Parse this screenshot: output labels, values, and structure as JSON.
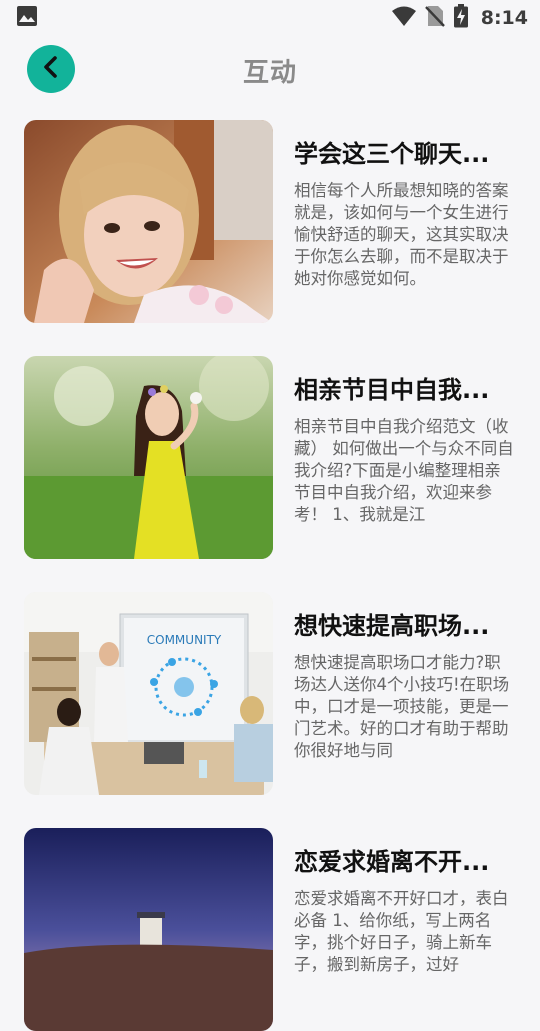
{
  "status_bar": {
    "time": "8:14",
    "icons": [
      "image-icon",
      "wifi-icon",
      "no-sim-icon",
      "battery-charging-icon"
    ]
  },
  "header": {
    "title": "互动",
    "back_icon": "chevron-left-icon",
    "accent_color": "#12b39a"
  },
  "articles": [
    {
      "title": "学会这三个聊天...",
      "summary": "相信每个人所最想知晓的答案就是，该如何与一个女生进行愉快舒适的聊天，这其实取决于你怎么去聊，而不是取决于她对你感觉如何。"
    },
    {
      "title": "相亲节目中自我...",
      "summary": "相亲节目中自我介绍范文（收藏） 如何做出一个与众不同自我介绍?下面是小编整理相亲节目中自我介绍，欢迎来参考！ 1、我就是江"
    },
    {
      "title": "想快速提高职场...",
      "summary": "想快速提高职场口才能力?职场达人送你4个小技巧!在职场中，口才是一项技能，更是一门艺术。好的口才有助于帮助你很好地与同"
    },
    {
      "title": "恋爱求婚离不开...",
      "summary": "恋爱求婚离不开好口才，表白必备 1、给你纸，写上两名字，挑个好日子，骑上新车子，搬到新房子，过好"
    }
  ],
  "thumb_texts": {
    "community_board": "COMMUNITY"
  }
}
